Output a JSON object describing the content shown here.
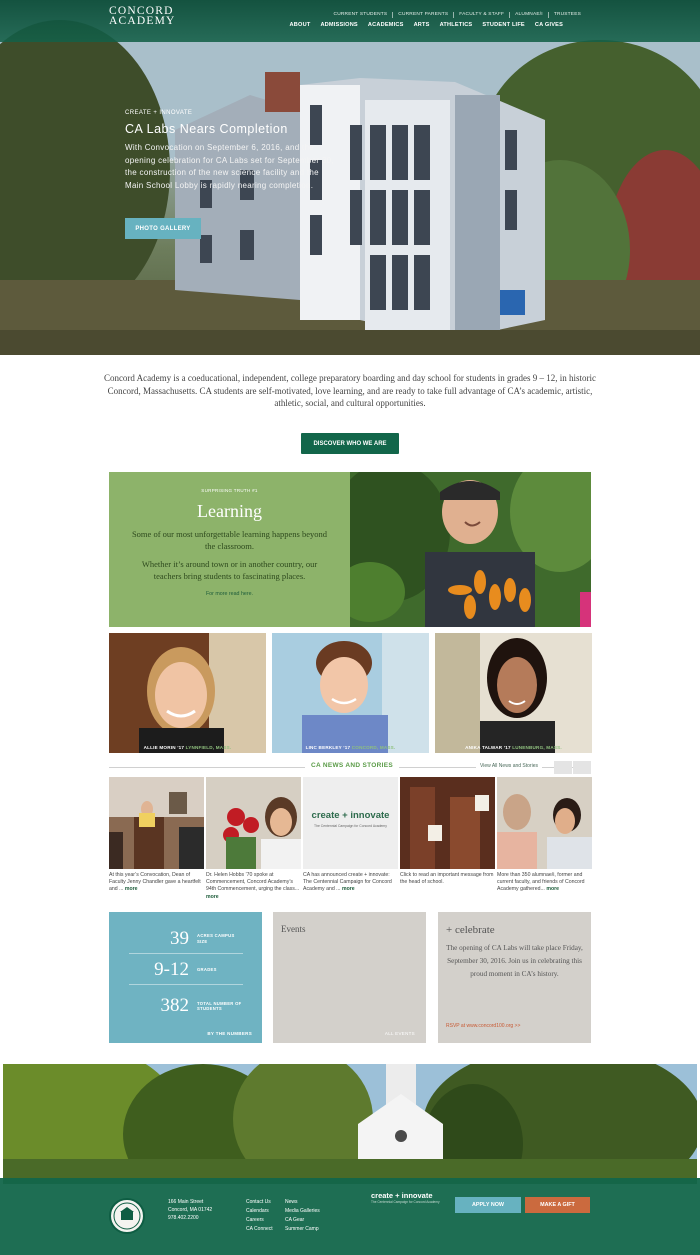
{
  "brand": {
    "line1": "CONCORD",
    "line2": "ACADEMY"
  },
  "utility_nav": [
    "CURRENT STUDENTS",
    "CURRENT PARENTS",
    "FACULTY & STAFF",
    "ALUMNAE/I",
    "TRUSTEES"
  ],
  "main_nav": [
    "ABOUT",
    "ADMISSIONS",
    "ACADEMICS",
    "ARTS",
    "ATHLETICS",
    "STUDENT LIFE",
    "CA GIVES"
  ],
  "hero": {
    "kicker": "CREATE + INNOVATE",
    "title": "CA Labs Nears Completion",
    "body": "With Convocation on September 6, 2016, and the opening celebration for CA Labs set for September 30, the construction of the new science facility and the Main School Lobby is rapidly nearing completion.",
    "button": "PHOTO GALLERY"
  },
  "intro": "Concord Academy is a coeducational, independent, college preparatory boarding and day school for students in grades 9 – 12, in historic Concord, Massachusetts. CA students are self-motivated, love learning, and are ready to take full advantage of CA’s academic, artistic, athletic, social, and cultural opportunities.",
  "discover_button": "DISCOVER WHO WE ARE",
  "learning": {
    "kicker": "SURPRISING TRUTH #1",
    "title": "Learning",
    "p1": "Some of our most unforgettable learning happens beyond the classroom.",
    "p2": "Whether it’s around town or in another country, our teachers bring students to fascinating places.",
    "link": "For more read here."
  },
  "students": [
    {
      "name": "ALLIE MORIN ’17",
      "town": "LYNNFIELD, MASS."
    },
    {
      "name": "LINC BERKLEY ’17",
      "town": "CONCORD, MASS."
    },
    {
      "name": "ANIKA TALWAR ’17",
      "town": "LUNENBURG, MASS."
    }
  ],
  "news": {
    "title": "CA NEWS AND STORIES",
    "view_all": "View All News and Stories",
    "items": [
      {
        "text": "At this year’s Convocation, Dean of Faculty Jenny Chandler gave a heartfelt and ...",
        "more": "more"
      },
      {
        "text": "Dr. Helen Hobbs ’70 spoke at Commencement, Concord Academy’s 94th Commencement, urging the class...",
        "more": "more"
      },
      {
        "text": "CA has announced create + innovate: The Centennial Campaign for Concord Academy and ...",
        "more": "more"
      },
      {
        "text": "Click to read an important message from the head of school.",
        "more": ""
      },
      {
        "text": "More than 350 alumnae/i, former and current faculty, and friends of Concord Academy gathered...",
        "more": "more"
      }
    ],
    "create_title": "create + innovate",
    "create_sub": "The Centennial Campaign for Concord Academy"
  },
  "stats": {
    "rows": [
      {
        "num": "39",
        "label": "ACRES CAMPUS SIZE"
      },
      {
        "num": "9-12",
        "label": "GRADES"
      },
      {
        "num": "382",
        "label": "TOTAL NUMBER OF STUDENTS"
      }
    ],
    "footer": "BY THE NUMBERS"
  },
  "events": {
    "title": "Events",
    "all": "ALL EVENTS"
  },
  "celebrate": {
    "title": "+ celebrate",
    "body": "The opening of CA Labs will take place Friday, September 30, 2016. Join us in celebrating this proud moment in CA’s history.",
    "link": "RSVP at www.concord100.org >>"
  },
  "footer": {
    "address": [
      "166 Main Street",
      "Concord, MA 01742",
      "978.402.2200"
    ],
    "links_col1": [
      "Contact Us",
      "Calendars",
      "Careers",
      "CA Connect"
    ],
    "links_col2": [
      "News",
      "Media Galleries",
      "CA Gear",
      "Summer Camp"
    ],
    "campaign_title": "create + innovate",
    "campaign_sub": "The Centennial Campaign for Concord Academy",
    "apply": "APPLY NOW",
    "gift": "MAKE A GIFT"
  },
  "colors": {
    "green": "#12664a",
    "teal": "#67b2c0",
    "olive": "#8db36a",
    "orange": "#cb6a3e",
    "stone": "#d3d0cb"
  }
}
